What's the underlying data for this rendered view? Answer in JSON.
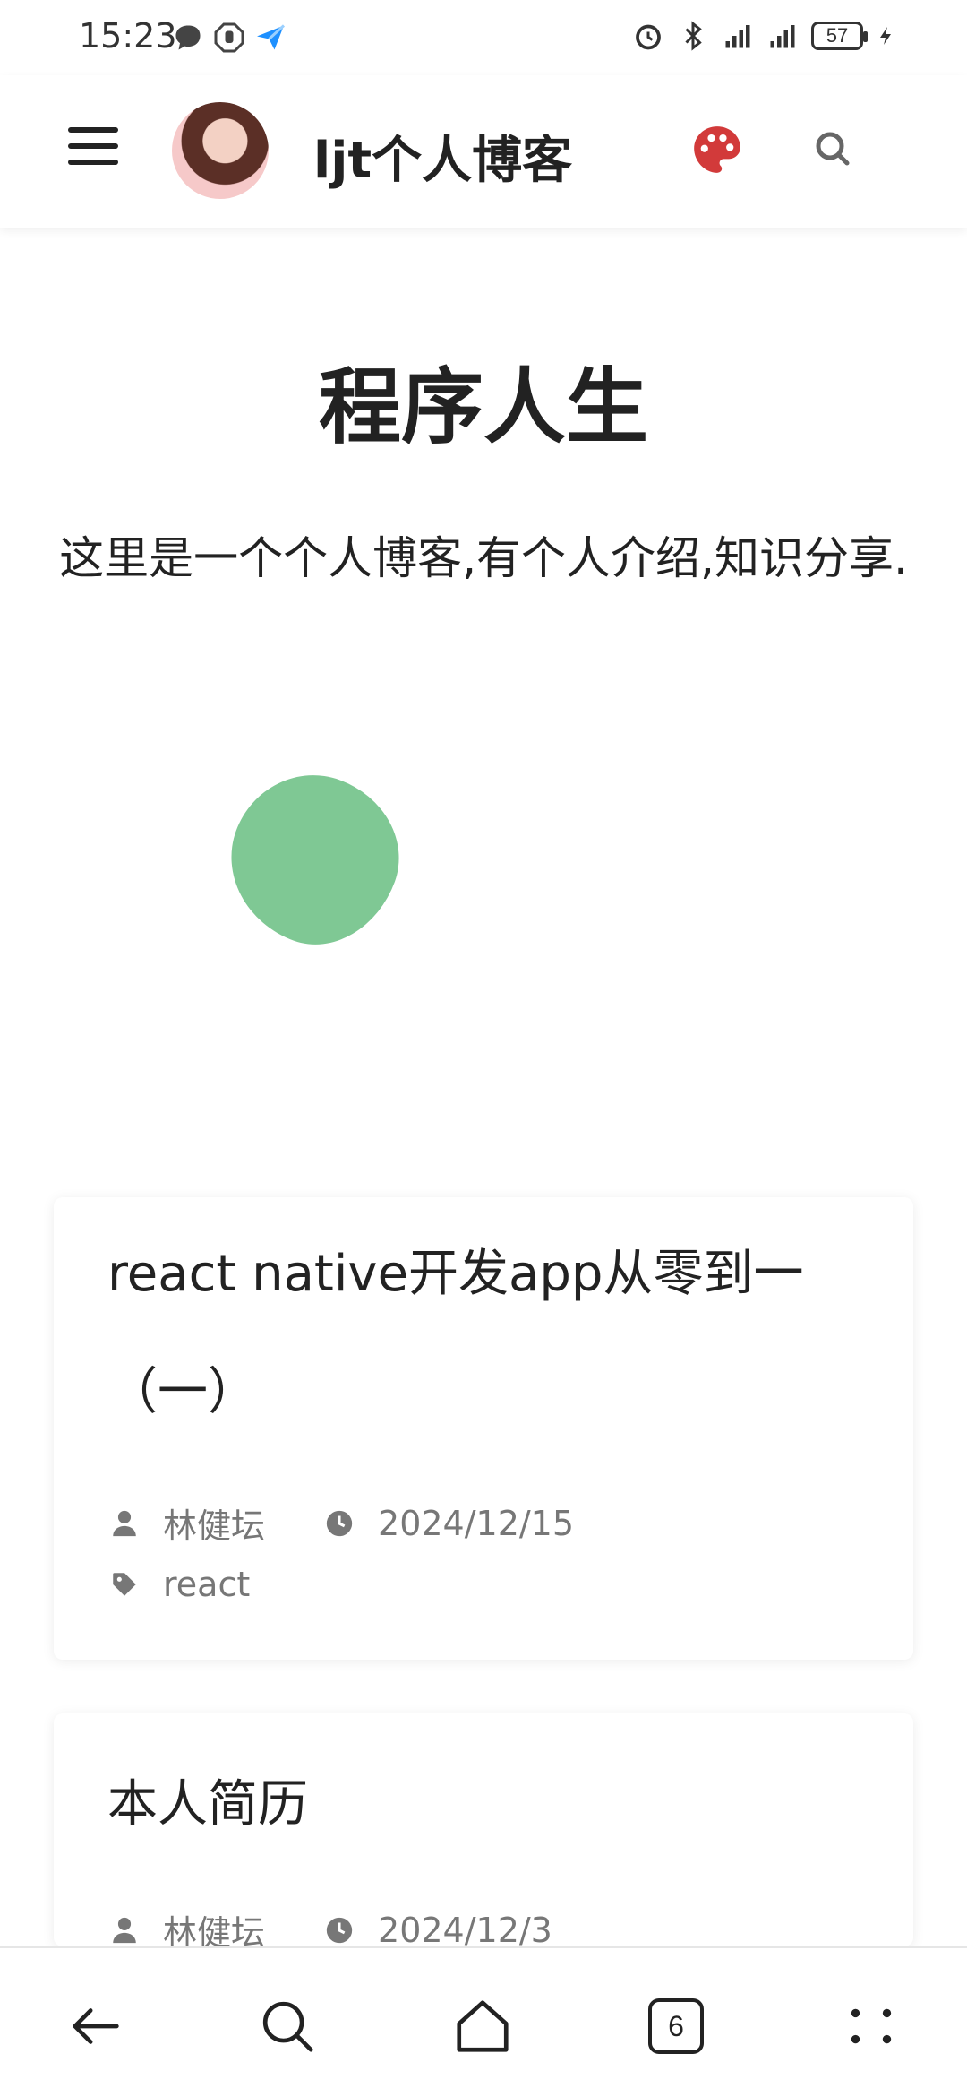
{
  "status_bar": {
    "time": "15:23",
    "battery": "57",
    "icons_left": [
      "chat-icon",
      "hand-icon",
      "send-icon"
    ],
    "icons_right": [
      "alarm-icon",
      "bluetooth-icon",
      "vibrate-icon",
      "signal-4g-icon",
      "signal-4g-icon",
      "battery-icon",
      "charging-icon"
    ]
  },
  "header": {
    "title": "ljt个人博客",
    "accent_color": "#d23a3a"
  },
  "hero": {
    "title": "程序人生",
    "subtitle": "这里是一个个人博客,有个人介绍,知识分享."
  },
  "posts": [
    {
      "title": "react native开发app从零到一（一）",
      "author": "林健坛",
      "date": "2024/12/15",
      "tag": "react"
    },
    {
      "title": "本人简历",
      "author": "林健坛",
      "date": "2024/12/3"
    }
  ],
  "bottom_nav": {
    "tab_count": "6",
    "items": [
      "back-icon",
      "search-icon",
      "home-icon",
      "tabs-icon",
      "more-icon"
    ]
  }
}
